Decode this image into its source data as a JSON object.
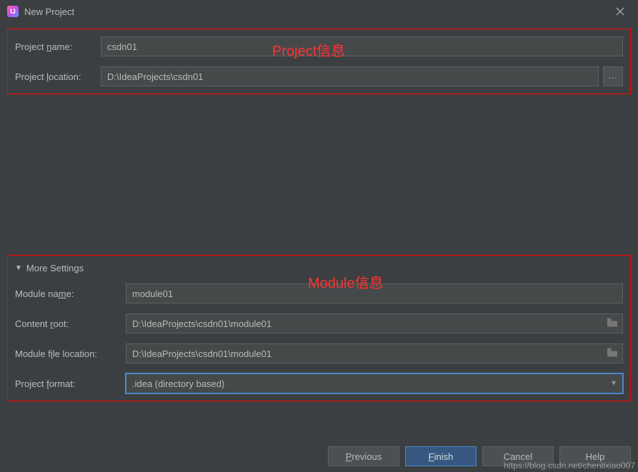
{
  "titlebar": {
    "title": "New Project"
  },
  "annotations": {
    "project": "Project信息",
    "module": "Module信息"
  },
  "project": {
    "name_label": "Project name:",
    "name_value": "csdn01",
    "location_label": "Project location:",
    "location_value": "D:\\IdeaProjects\\csdn01",
    "browse_label": "..."
  },
  "more": {
    "header": "More Settings",
    "module_name_label": "Module name:",
    "module_name_value": "module01",
    "content_root_label": "Content root:",
    "content_root_value": "D:\\IdeaProjects\\csdn01\\module01",
    "module_file_label": "Module file location:",
    "module_file_value": "D:\\IdeaProjects\\csdn01\\module01",
    "project_format_label": "Project format:",
    "project_format_value": ".idea (directory based)"
  },
  "footer": {
    "previous": "Previous",
    "finish": "Finish",
    "cancel": "Cancel",
    "help": "Help"
  },
  "watermark": "https://blog.csdn.net/chenlixiao007"
}
